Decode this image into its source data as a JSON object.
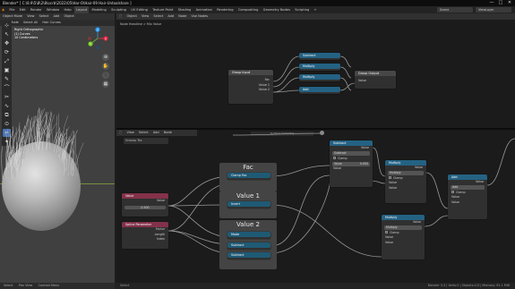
{
  "titlebar": {
    "title": "Blender* [ C:\\8.9\\5\\8\\2\\8\\ocrb\\2022\\05\\Har-O\\Hair-09 Hair-Untoolshare ]",
    "minimize": "—",
    "maximize": "□",
    "close": "✕"
  },
  "menubar": {
    "menus": [
      "File",
      "Edit",
      "Render",
      "Window",
      "Help"
    ],
    "workspaces": [
      "Layout",
      "Modeling",
      "Sculpting",
      "UV Editing",
      "Texture Paint",
      "Shading",
      "Animation",
      "Rendering",
      "Compositing",
      "Geometry Nodes",
      "Scripting",
      "+"
    ],
    "active_workspace": "Layout",
    "scene": "Scene",
    "view_layer": "ViewLayer"
  },
  "viewport": {
    "header": [
      "Object Mode",
      "View",
      "Select",
      "Add",
      "Object"
    ],
    "header2": [
      "Global",
      "⊕",
      "🧲",
      "⊘",
      "⊞"
    ],
    "subheader": [
      "Hair Mode",
      "Select All",
      "Hair Curves"
    ],
    "info": [
      "Right Orthographic",
      "(1) Curves",
      "10 Centimeters"
    ],
    "tools": [
      "⊹",
      "↖",
      "✥",
      "⟳",
      "⤢",
      "▣",
      "✎",
      "⌒",
      "✂",
      "∿",
      "⧉",
      "⊙",
      "✂",
      "✦"
    ],
    "active_tool_index": 12,
    "gizmo_labels": {
      "x": "X",
      "y": "Y",
      "z": "Z"
    },
    "footer": [
      "Select",
      "Pan View",
      "Context Menu"
    ]
  },
  "node_editor_top": {
    "header": [
      "Object",
      "View",
      "Select",
      "Add",
      "Node"
    ],
    "use_nodes": "Use Nodes",
    "breadcrumb": [
      "Node Headline",
      "Mix Value"
    ],
    "group_input": {
      "title": "Group Input",
      "sockets": [
        "Fac",
        "Value 1",
        "Value 2"
      ]
    },
    "group_output": {
      "title": "Group Output",
      "sockets": [
        "Value"
      ]
    },
    "mini_nodes": [
      "Subtract",
      "Multiply",
      "Multiply",
      "Add"
    ]
  },
  "node_editor_bot": {
    "header": [
      "View",
      "Select",
      "Add",
      "Node"
    ],
    "unwrap_label": "Unwrap Tex",
    "value_node": {
      "title": "Value",
      "socket": "Value",
      "value": "0.500"
    },
    "subheader_fields": [
      "Surface Sampling",
      "Fac 1"
    ],
    "frames": [
      {
        "label": "Fac",
        "node": "Clamp Fac"
      },
      {
        "label": "Value 1",
        "node": "Invert"
      },
      {
        "label": "Value 2",
        "nodes": [
          "Mode",
          "Subtract",
          "Subtract"
        ]
      }
    ],
    "curve_param": {
      "title": "Spline Parameter",
      "sockets": [
        "Factor",
        "Length",
        "Index"
      ]
    },
    "subtract_node": {
      "title": "Subtract",
      "out": "Value",
      "op": "Subtract",
      "clamp": "Clamp",
      "in1": "Value",
      "in1_val": "0.000",
      "in2": "Value"
    },
    "multiply_node_a": {
      "title": "Multiply",
      "out": "Value",
      "op": "Multiply",
      "clamp": "Clamp",
      "in1": "Value",
      "in2": "Value"
    },
    "multiply_node_b": {
      "title": "Multiply",
      "out": "Value",
      "op": "Multiply",
      "clamp": "Clamp",
      "in1": "Value",
      "in2": "Value"
    },
    "add_node": {
      "title": "Add",
      "out": "Value",
      "op": "Add",
      "clamp": "Clamp",
      "in1": "Value",
      "in2": "Value"
    }
  },
  "statusbar": {
    "left": "Select",
    "right": "Blender 3.3 | Verts:0 | Objects:1/3 | Memory: 92.1 MiB"
  }
}
